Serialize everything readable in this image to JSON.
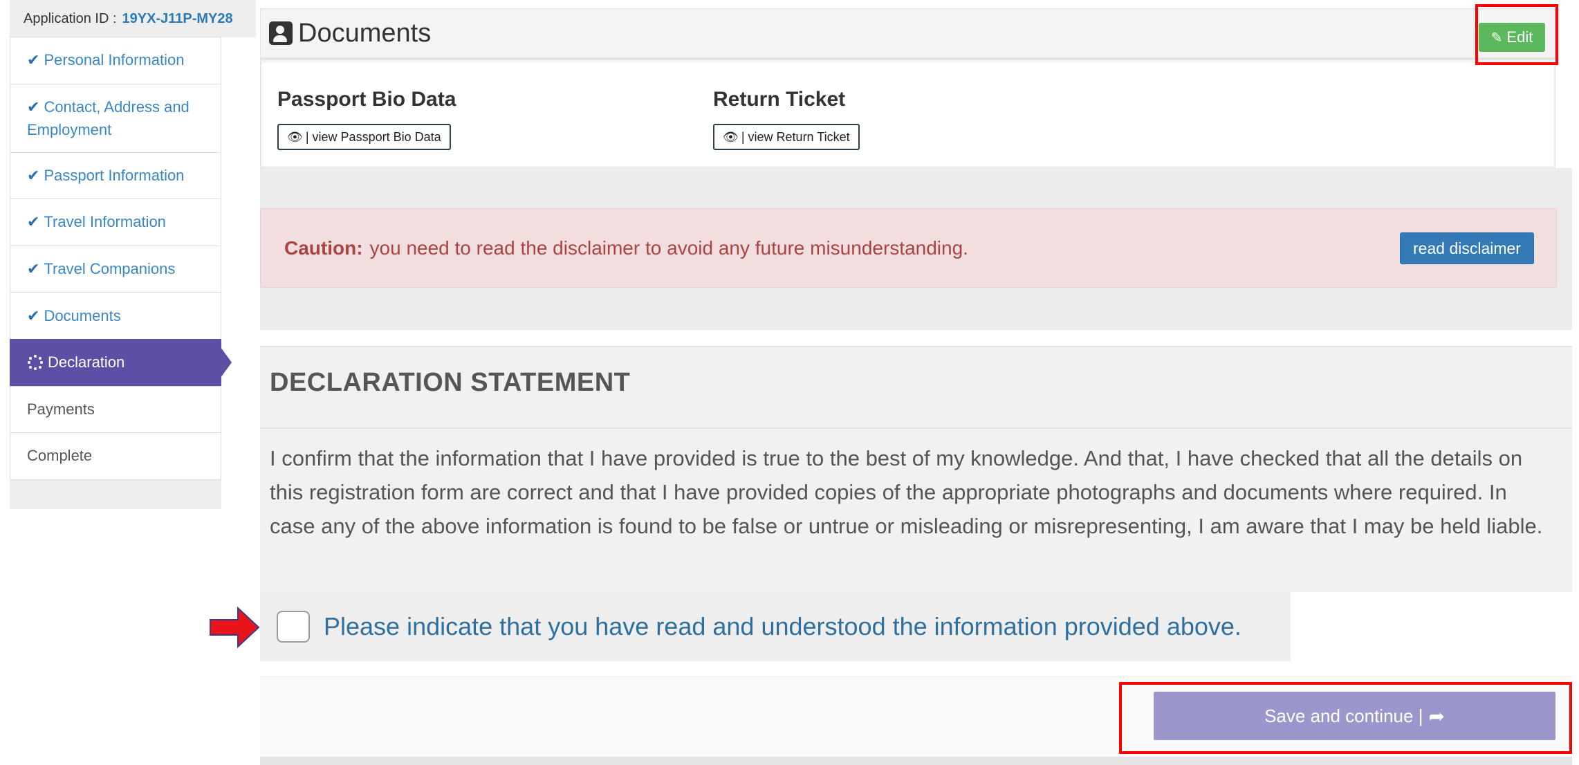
{
  "application": {
    "label": "Application ID :",
    "id": "19YX-J11P-MY28"
  },
  "sidebar": {
    "items": [
      {
        "label": "Personal Information",
        "state": "done"
      },
      {
        "label": "Contact, Address and Employment",
        "state": "done"
      },
      {
        "label": "Passport Information",
        "state": "done"
      },
      {
        "label": "Travel Information",
        "state": "done"
      },
      {
        "label": "Travel Companions",
        "state": "done"
      },
      {
        "label": "Documents",
        "state": "done"
      },
      {
        "label": "Declaration",
        "state": "active"
      },
      {
        "label": "Payments",
        "state": "pending"
      },
      {
        "label": "Complete",
        "state": "pending"
      }
    ]
  },
  "documents": {
    "title": "Documents",
    "edit_label": "Edit",
    "items": [
      {
        "title": "Passport Bio Data",
        "button": "| view Passport Bio Data"
      },
      {
        "title": "Return Ticket",
        "button": "| view Return Ticket"
      }
    ]
  },
  "caution": {
    "strong": "Caution:",
    "text": "you need to read the disclaimer to avoid any future misunderstanding.",
    "button": "read disclaimer"
  },
  "declaration": {
    "title": "DECLARATION STATEMENT",
    "text": "I confirm that the information that I have provided is true to the best of my knowledge. And that, I have checked that all the details on this registration form are correct and that I have provided copies of the appropriate photographs and documents where required. In case any of the above information is found to be false or untrue or misleading or misrepresenting, I am aware that I may be held liable.",
    "ack_label": "Please indicate that you have read and understood the information provided above.",
    "ack_checked": false
  },
  "actions": {
    "save_label": "Save and continue |"
  },
  "colors": {
    "accent": "#5c4fa6",
    "link": "#3a86c4",
    "edit_green": "#5cb85c",
    "caution_bg": "#f2dede",
    "caution_text": "#a94442",
    "disclaimer_blue": "#337ab7",
    "save_purple": "#9b97cc",
    "highlight_red": "#ff0000"
  },
  "icons": {
    "done": "check-icon",
    "active": "spinner-icon",
    "docs": "user-document-icon",
    "edit": "edit-icon",
    "view": "eye-icon",
    "save": "share-arrow-icon",
    "pointer": "red-arrow-icon"
  }
}
